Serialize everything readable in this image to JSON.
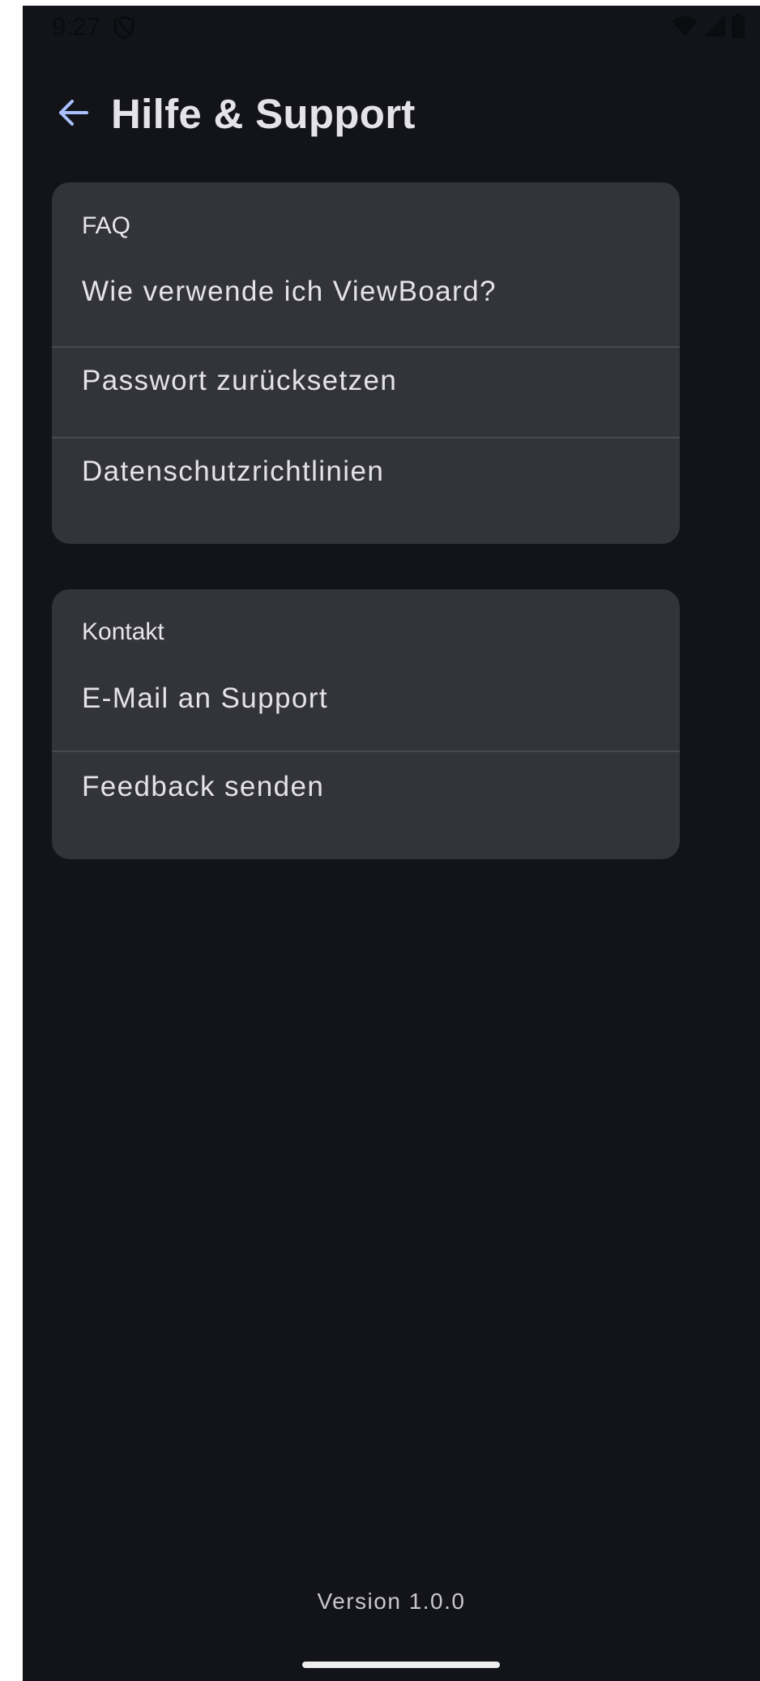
{
  "status_bar": {
    "time": "9:27",
    "icons": [
      "shield-icon",
      "wifi-icon",
      "cellular-icon",
      "battery-icon"
    ]
  },
  "header": {
    "back_icon": "arrow-left-icon",
    "title": "Hilfe & Support"
  },
  "sections": [
    {
      "title": "FAQ",
      "items": [
        {
          "label": "Wie verwende ich ViewBoard?"
        },
        {
          "label": "Passwort zurücksetzen"
        },
        {
          "label": "Datenschutzrichtlinien"
        }
      ]
    },
    {
      "title": "Kontakt",
      "items": [
        {
          "label": "E-Mail an Support"
        },
        {
          "label": "Feedback senden"
        }
      ]
    }
  ],
  "footer": {
    "version": "Version 1.0.0"
  },
  "colors": {
    "background": "#131419",
    "card": "#33343a",
    "accent": "#a9c2ff",
    "text": "#e4e2ea"
  }
}
